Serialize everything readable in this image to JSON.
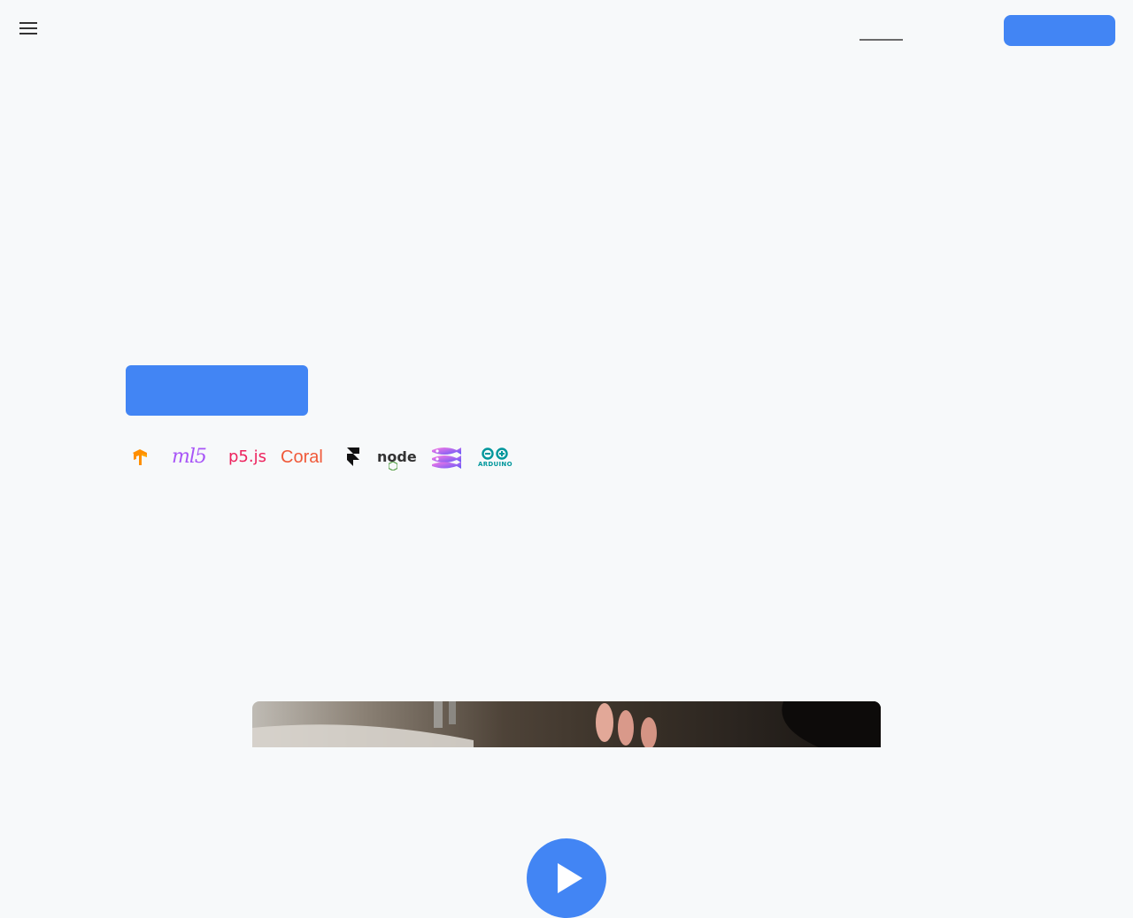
{
  "header": {
    "menu_icon": "hamburger-menu-icon",
    "nav_active_label": "",
    "cta_label": ""
  },
  "hero": {
    "cta_label": ""
  },
  "tech_logos": [
    {
      "name": "tensorflow",
      "icon": "tensorflow-logo"
    },
    {
      "name": "ml5",
      "text": "ml5"
    },
    {
      "name": "p5js",
      "text": "p5.js"
    },
    {
      "name": "coral",
      "text": "Coral"
    },
    {
      "name": "framer",
      "icon": "framer-logo"
    },
    {
      "name": "nodejs",
      "text": "node"
    },
    {
      "name": "glitch",
      "icon": "glitch-fish-logo"
    },
    {
      "name": "arduino",
      "text": "ARDUINO"
    }
  ],
  "video": {
    "play_icon": "play-icon"
  },
  "colors": {
    "accent": "#4285f4",
    "background": "#f7f9fa",
    "tensorflow_orange": "#ff8f00",
    "ml5_purple": "#a855f7",
    "p5_pink": "#ed225d",
    "coral_red": "#f05a3a",
    "node_green": "#539e43",
    "arduino_teal": "#00979c"
  }
}
